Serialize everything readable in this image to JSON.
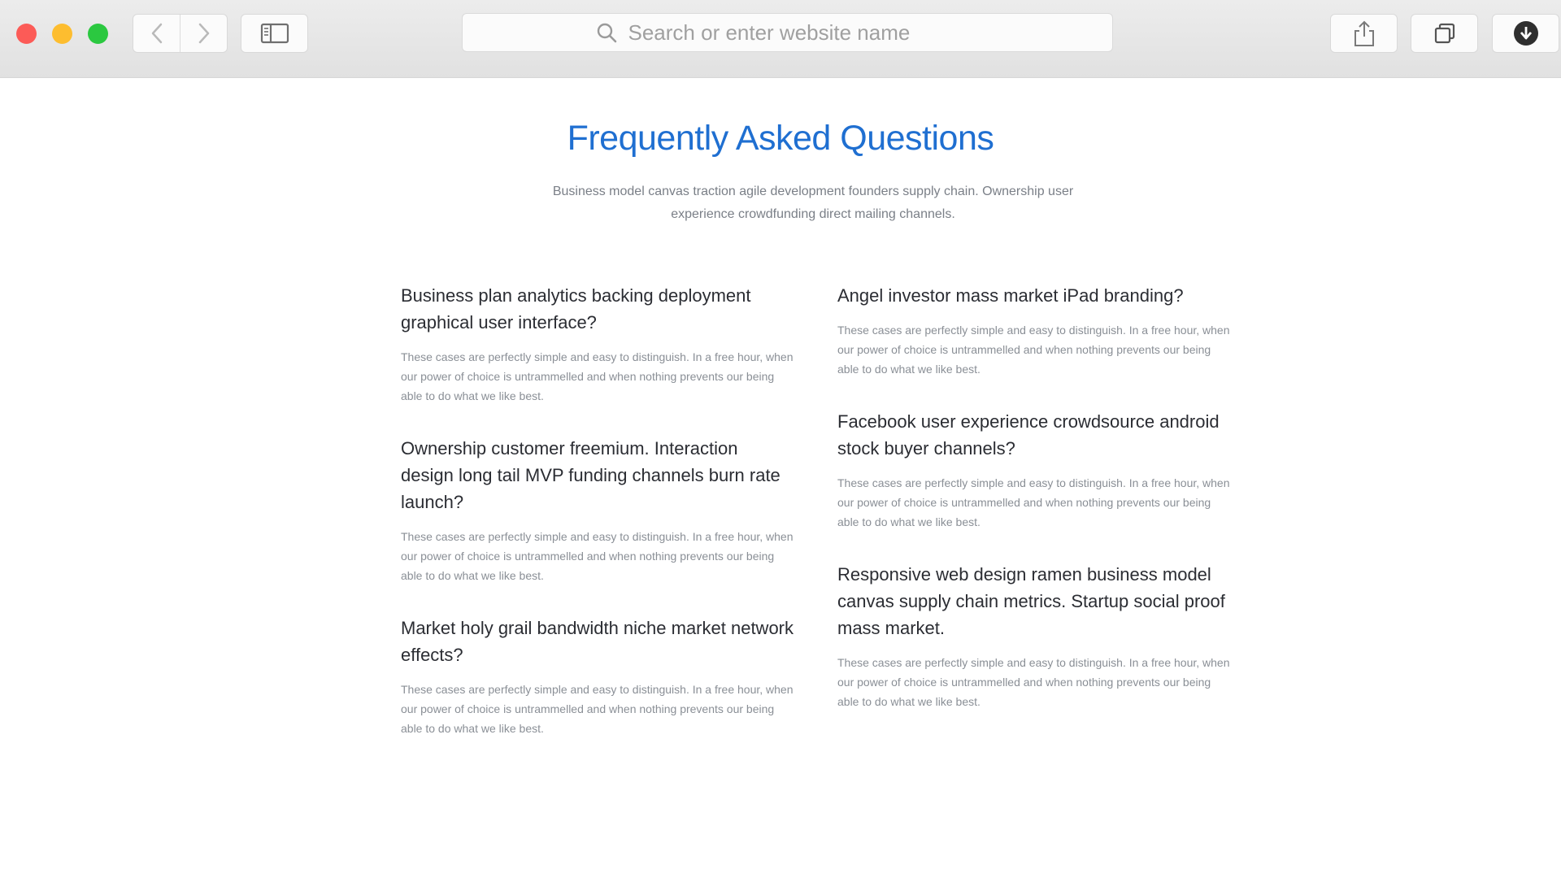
{
  "browser": {
    "address_placeholder": "Search or enter website name",
    "colors": {
      "close": "#fc5b57",
      "minimize": "#fdbd2f",
      "maximize": "#2bc840"
    },
    "icons": [
      "back-icon",
      "forward-icon",
      "sidebar-icon",
      "search-icon",
      "share-icon",
      "tabs-icon",
      "download-icon"
    ]
  },
  "page": {
    "title": "Frequently Asked Questions",
    "subtitle": "Business model canvas traction agile development founders supply chain. Ownership user experience crowdfunding direct mailing channels.",
    "accent_color": "#1f6fd1",
    "faq_left": [
      {
        "question": "Business plan analytics backing deployment graphical user interface?",
        "answer": "These cases are perfectly simple and easy to distinguish. In a free hour, when our power of choice is untrammelled and when nothing prevents our being able to do what we like best."
      },
      {
        "question": "Ownership customer freemium. Interaction design long tail MVP funding channels burn rate launch?",
        "answer": "These cases are perfectly simple and easy to distinguish. In a free hour, when our power of choice is untrammelled and when nothing prevents our being able to do what we like best."
      },
      {
        "question": "Market holy grail bandwidth niche market network effects?",
        "answer": "These cases are perfectly simple and easy to distinguish. In a free hour, when our power of choice is untrammelled and when nothing prevents our being able to do what we like best."
      }
    ],
    "faq_right": [
      {
        "question": "Angel investor mass market iPad branding?",
        "answer": "These cases are perfectly simple and easy to distinguish. In a free hour, when our power of choice is untrammelled and when nothing prevents our being able to do what we like best."
      },
      {
        "question": "Facebook user experience crowdsource android stock buyer channels?",
        "answer": "These cases are perfectly simple and easy to distinguish. In a free hour, when our power of choice is untrammelled and when nothing prevents our being able to do what we like best."
      },
      {
        "question": "Responsive web design ramen business model canvas supply chain metrics. Startup social proof mass market.",
        "answer": "These cases are perfectly simple and easy to distinguish. In a free hour, when our power of choice is untrammelled and when nothing prevents our being able to do what we like best."
      }
    ]
  }
}
